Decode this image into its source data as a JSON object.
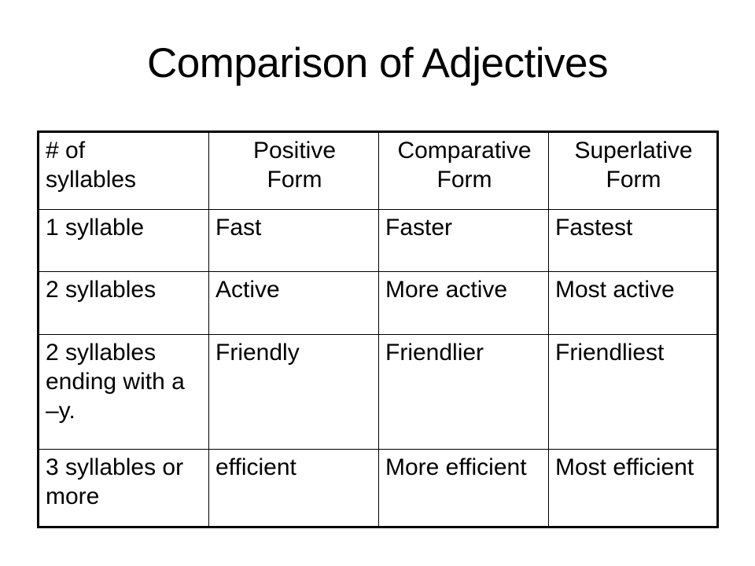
{
  "slide": {
    "title": "Comparison of Adjectives",
    "background_color": "#ffffff",
    "text_color": "#000000"
  },
  "table": {
    "border_color": "#000000",
    "headers": [
      "# of\nsyllables",
      "Positive\nForm",
      "Comparative\nForm",
      "Superlative\nForm"
    ],
    "rows": [
      {
        "syllables": "1 syllable",
        "positive": "Fast",
        "comparative": "Faster",
        "superlative": "Fastest"
      },
      {
        "syllables": "2 syllables",
        "positive": "Active",
        "comparative": "More active",
        "superlative": "Most active"
      },
      {
        "syllables": "2 syllables ending with a –y.",
        "positive": "Friendly",
        "comparative": "Friendlier",
        "superlative": "Friendliest"
      },
      {
        "syllables": "3 syllables or more",
        "positive": "efficient",
        "comparative": "More efficient",
        "superlative": "Most efficient"
      }
    ]
  }
}
